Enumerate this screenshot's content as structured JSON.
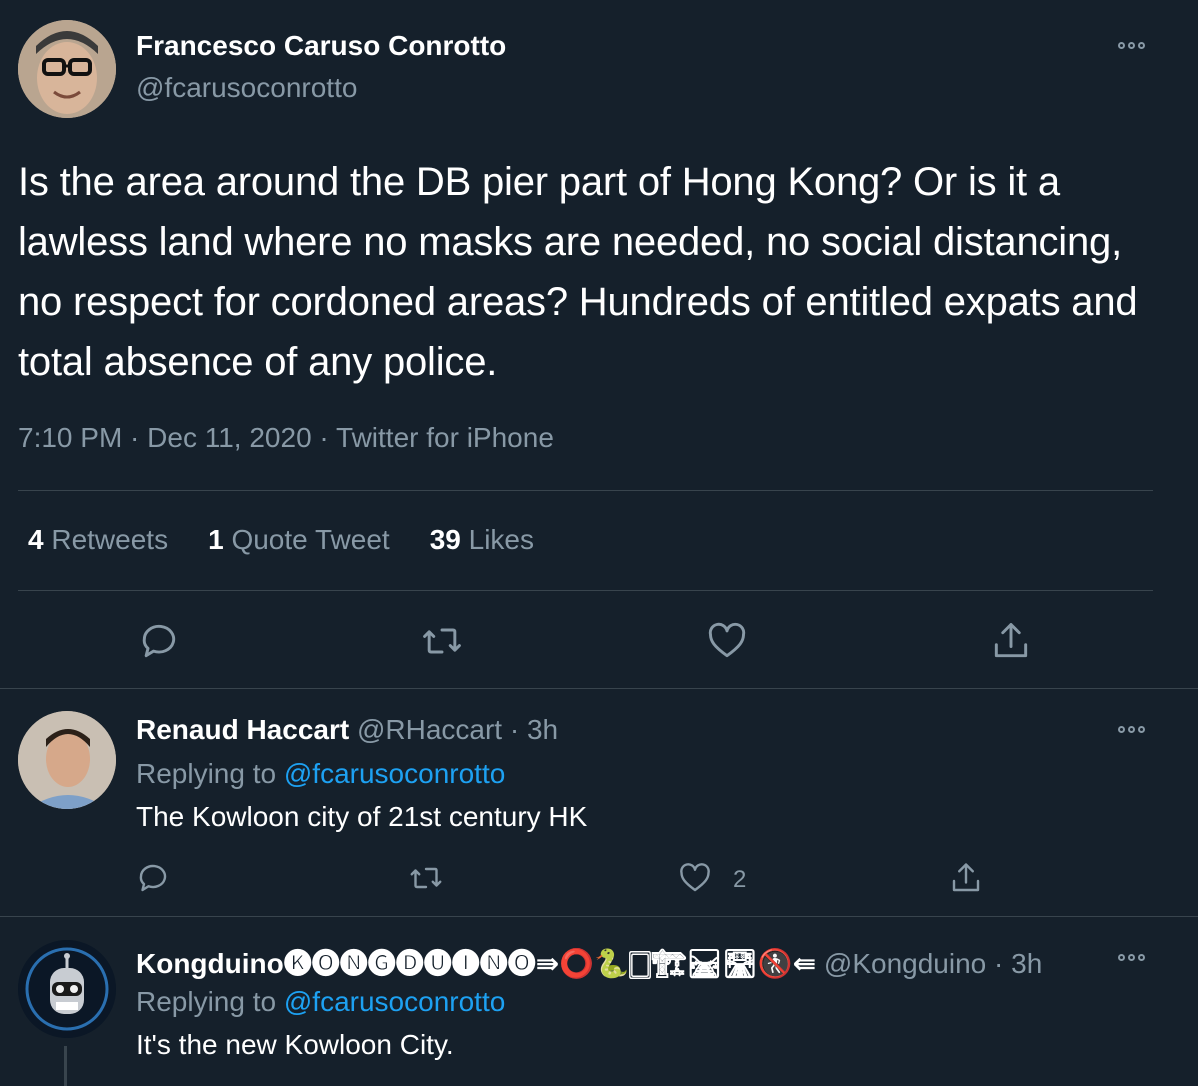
{
  "main_tweet": {
    "author_name": "Francesco Caruso Conrotto",
    "author_handle": "@fcarusoconrotto",
    "text": "Is the area around the DB pier part of Hong Kong? Or is it a lawless land where no masks are needed, no social distancing, no respect for cordoned areas? Hundreds of entitled expats and total absence of any police.",
    "meta": "7:10 PM · Dec 11, 2020 · Twitter for iPhone",
    "stats": {
      "retweets_count": "4",
      "retweets_label": "Retweets",
      "quotes_count": "1",
      "quotes_label": "Quote Tweet",
      "likes_count": "39",
      "likes_label": "Likes"
    }
  },
  "replies": [
    {
      "author_name": "Renaud Haccart",
      "author_handle_time": "@RHaccart · 3h",
      "replying_label": "Replying to",
      "replying_to": "@fcarusoconrotto",
      "text": "The Kowloon city of 21st century HK",
      "like_count": "2"
    },
    {
      "author_name": "Kongduino🅚🅞🅝🅖🅓🅤🅘🅝🅞⇛⭕️🐍🀆🏗🛤🛣🚷⇚",
      "author_handle_time": "@Kongduino · 3h",
      "replying_label": "Replying to",
      "replying_to": "@fcarusoconrotto",
      "text": "It's the new Kowloon City."
    }
  ],
  "icons": [
    "more-icon",
    "reply-icon",
    "retweet-icon",
    "like-icon",
    "share-icon"
  ],
  "colors": {
    "background": "#15202b",
    "muted": "#8899a6",
    "link": "#1da1f2",
    "divider": "#38444d"
  }
}
